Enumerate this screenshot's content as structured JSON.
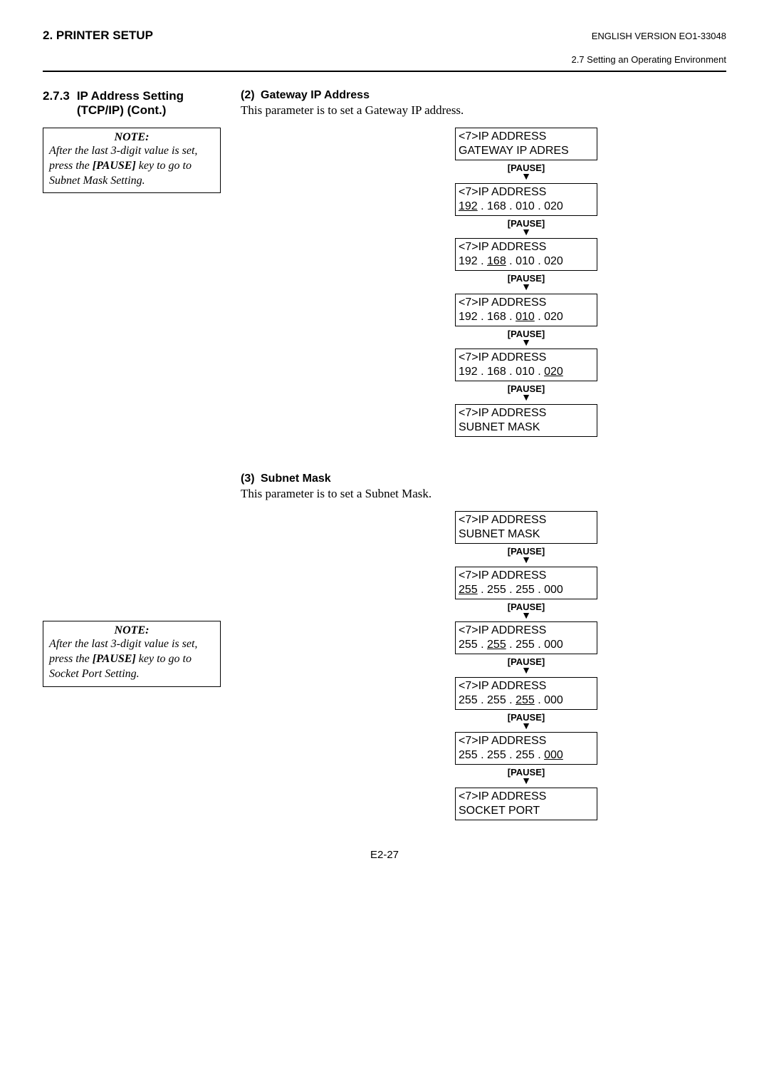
{
  "header": {
    "left": "2. PRINTER SETUP",
    "right": "ENGLISH VERSION EO1-33048",
    "sub": "2.7 Setting an Operating Environment"
  },
  "section_left": {
    "number": "2.7.3",
    "title": "IP Address Setting (TCP/IP) (Cont.)"
  },
  "note1": {
    "title": "NOTE:",
    "line1": "After the last 3-digit value is set, press the ",
    "key": "[PAUSE]",
    "line2": " key to go to Subnet Mask Setting."
  },
  "note2": {
    "title": "NOTE:",
    "line1": "After the last 3-digit value is set, press the ",
    "key": "[PAUSE]",
    "line2": " key to go to Socket Port Setting."
  },
  "gateway": {
    "numparen": "(2)",
    "head": "Gateway IP Address",
    "desc": "This parameter is to set a Gateway IP address.",
    "pause": "[PAUSE]",
    "box1_l1": "<7>IP ADDRESS",
    "box1_l2": "GATEWAY IP ADRES",
    "ip_l1": "<7>IP ADDRESS",
    "ip_l2": "192 . 168 . 010 . 020",
    "box6_l1": "<7>IP ADDRESS",
    "box6_l2": "SUBNET MASK"
  },
  "subnet": {
    "numparen": "(3)",
    "head": "Subnet Mask",
    "desc": "This parameter is to set a Subnet Mask.",
    "pause": "[PAUSE]",
    "box1_l1": "<7>IP ADDRESS",
    "box1_l2": "SUBNET MASK",
    "ip_l1": "<7>IP ADDRESS",
    "ip_l2": "255 . 255 . 255 . 000",
    "box6_l1": "<7>IP ADDRESS",
    "box6_l2": "SOCKET PORT"
  },
  "page_number": "E2-27"
}
